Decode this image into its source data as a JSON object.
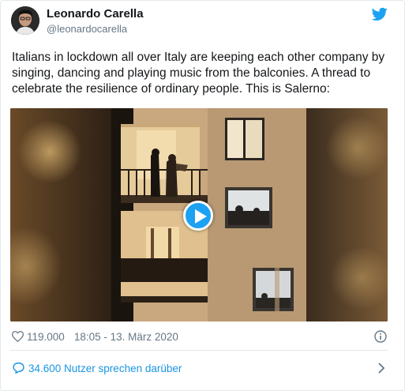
{
  "author": {
    "name": "Leonardo Carella",
    "handle": "@leonardocarella"
  },
  "tweet": {
    "text": "Italians in lockdown all over Italy are keeping each other company by singing, dancing and playing music from the balconies. A thread to celebrate the resilience of ordinary people. This is Salerno:"
  },
  "media": {
    "type": "video",
    "play_icon": "play-icon"
  },
  "meta": {
    "likes": "119.000",
    "timestamp": "18:05 - 13. März 2020"
  },
  "footer": {
    "replies_label": "34.600 Nutzer sprechen darüber"
  },
  "colors": {
    "accent": "#1da1f2",
    "link": "#1b95e0",
    "muted": "#657786",
    "text": "#14171a",
    "border": "#e1e8ed"
  },
  "icons": [
    "twitter-bird-icon",
    "heart-icon",
    "info-icon",
    "reply-bubble-icon",
    "chevron-right-icon",
    "play-icon"
  ]
}
